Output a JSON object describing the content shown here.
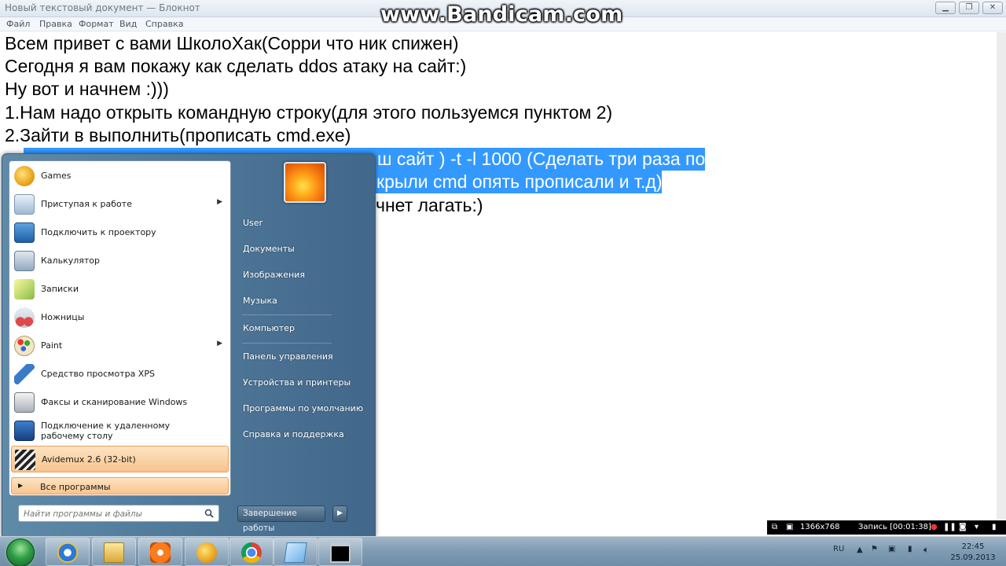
{
  "window": {
    "title": "Новый текстовый документ — Блокнот",
    "controls": {
      "minimize": "▁",
      "maximize": "❐",
      "close": "✕"
    }
  },
  "menu": [
    "Файл",
    "Правка",
    "Формат",
    "Вид",
    "Справка"
  ],
  "watermark": "www.Bandicam.com",
  "document": {
    "lines": [
      "Всем привет с вами ШколоХак(Сорри что ник спижен)",
      "Сегодня я вам покажу как сделать ddos атаку на сайт:)",
      "Ну вот и начнем :)))",
      "1.Нам надо открыть командную строку(для этого пользуемся пунктом 2)",
      "2.Зайти в выполнить(прописать cmd.exe)"
    ],
    "line6_visible": "ш сайт ) -t -l 1000 (Сделать три раза по",
    "line7_visible": "крыли cmd опять прописали и т.д)",
    "line8_visible": "чнет лагать:)"
  },
  "start_menu": {
    "programs": [
      {
        "label": "Games",
        "icon": "games-icon"
      },
      {
        "label": "Приступая к работе",
        "icon": "getting-started-icon",
        "submenu": true
      },
      {
        "label": "Подключить к проектору",
        "icon": "projector-icon"
      },
      {
        "label": "Калькулятор",
        "icon": "calculator-icon"
      },
      {
        "label": "Записки",
        "icon": "sticky-notes-icon"
      },
      {
        "label": "Ножницы",
        "icon": "snipping-tool-icon"
      },
      {
        "label": "Paint",
        "icon": "paint-icon",
        "submenu": true
      },
      {
        "label": "Средство просмотра XPS",
        "icon": "xps-viewer-icon"
      },
      {
        "label": "Факсы и сканирование Windows",
        "icon": "fax-scan-icon"
      },
      {
        "label": "Подключение к удаленному рабочему столу",
        "icon": "remote-desktop-icon"
      },
      {
        "label": "Avidemux 2.6 (32-bit)",
        "icon": "avidemux-icon",
        "highlighted": true
      }
    ],
    "all_programs": "Все программы",
    "search_placeholder": "Найти программы и файлы",
    "right_items": [
      "User",
      "Документы",
      "Изображения",
      "Музыка",
      "Компьютер",
      "Панель управления",
      "Устройства и принтеры",
      "Программы по умолчанию",
      "Справка и поддержка"
    ],
    "shutdown": "Завершение работы"
  },
  "taskbar": {
    "buttons": [
      "internet-explorer-icon",
      "file-explorer-icon",
      "media-player-icon",
      "games-icon",
      "chrome-icon",
      "notepad-icon",
      "cmd-icon"
    ],
    "language": "RU",
    "time": "22:45",
    "date": "25.09.2013"
  },
  "recorder": {
    "resolution": "1366x768",
    "status": "Запись [00:01:38]"
  }
}
